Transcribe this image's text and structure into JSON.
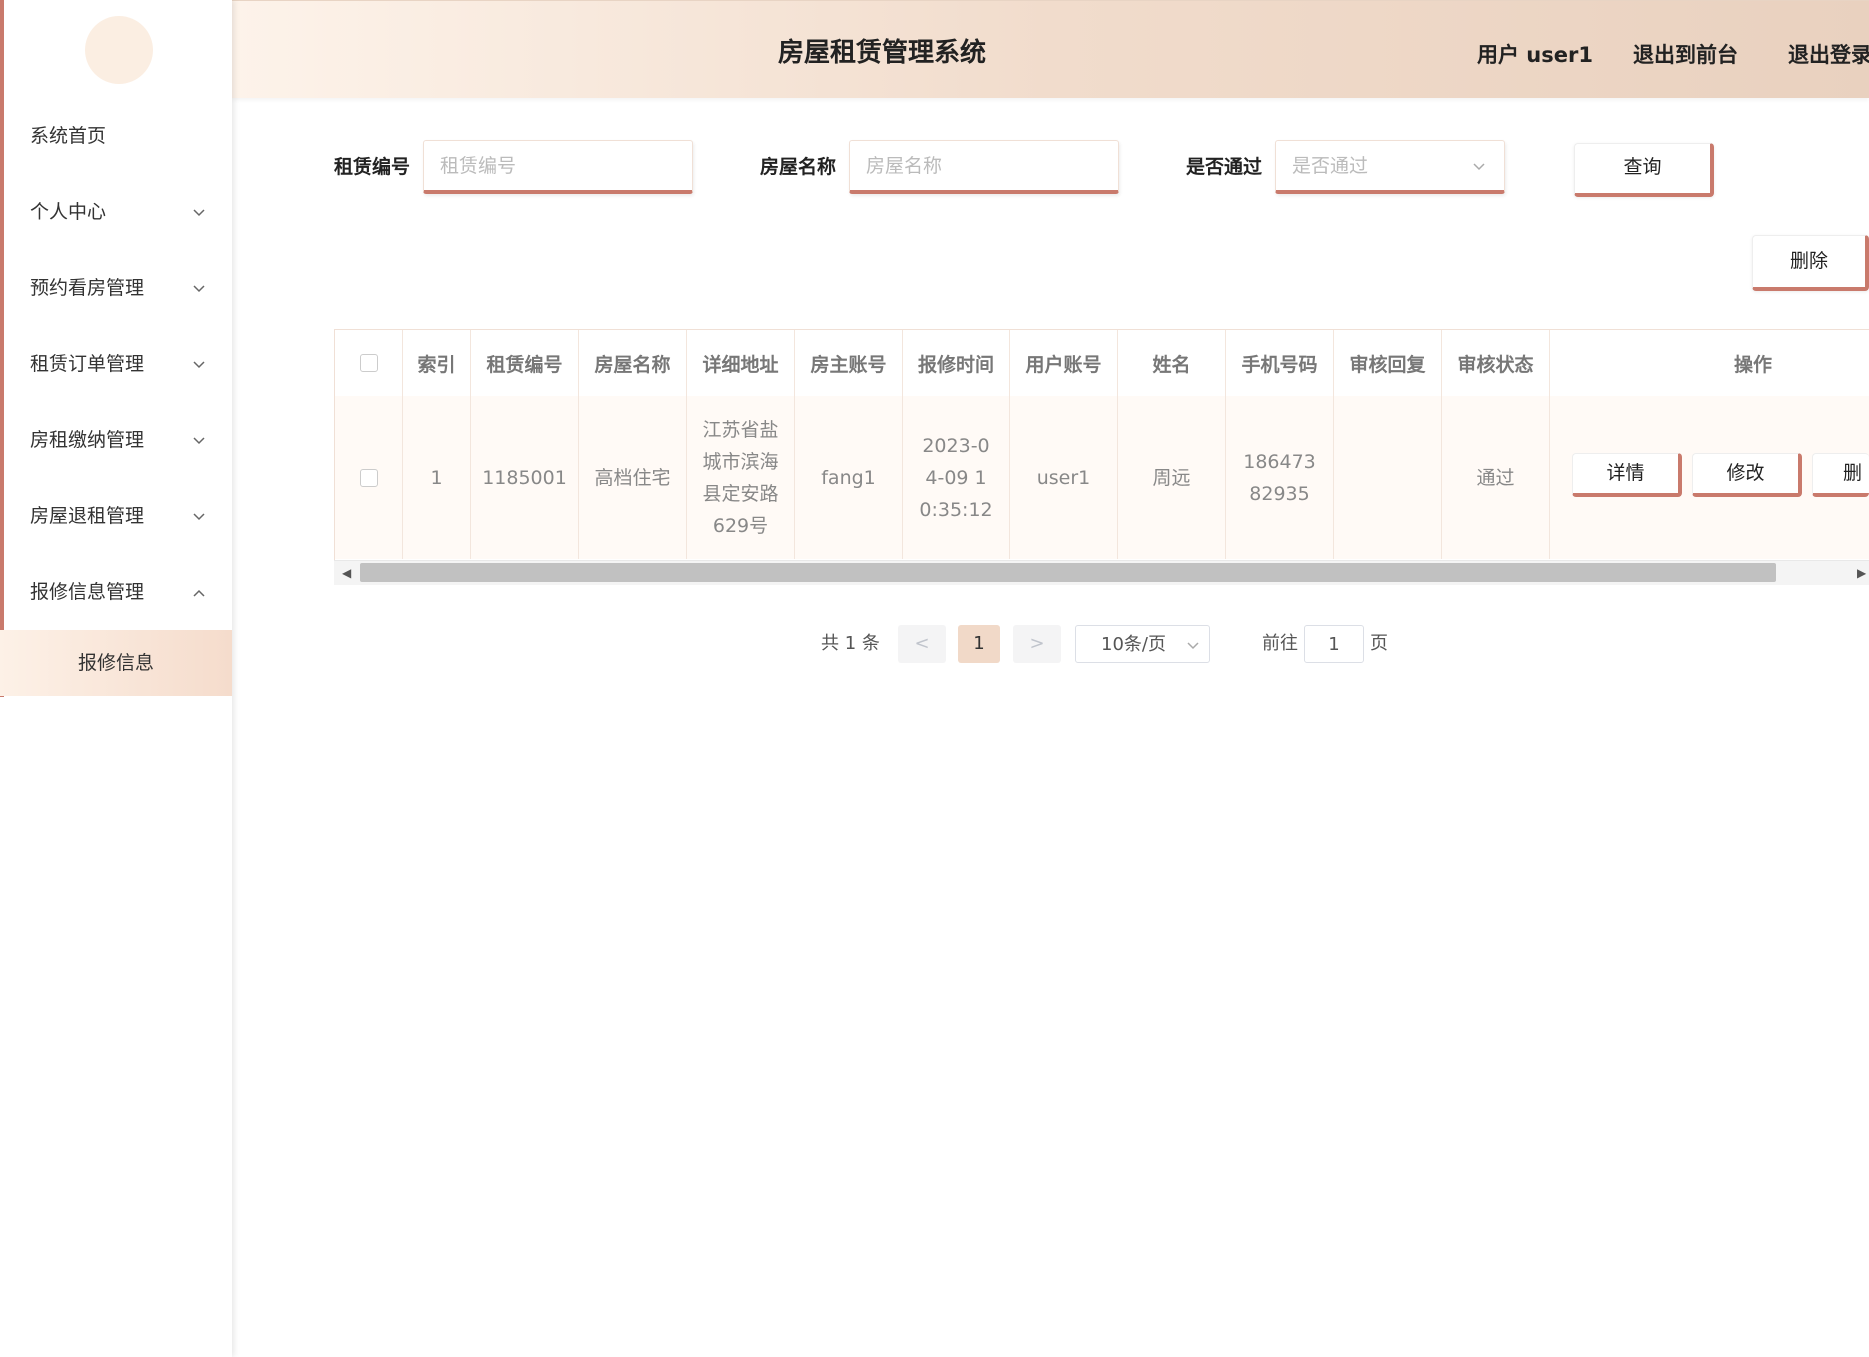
{
  "sidebar": {
    "items": [
      {
        "label": "系统首页",
        "has_chevron": false
      },
      {
        "label": "个人中心",
        "has_chevron": true
      },
      {
        "label": "预约看房管理",
        "has_chevron": true
      },
      {
        "label": "租赁订单管理",
        "has_chevron": true
      },
      {
        "label": "房租缴纳管理",
        "has_chevron": true
      },
      {
        "label": "房屋退租管理",
        "has_chevron": true
      },
      {
        "label": "报修信息管理",
        "has_chevron": true,
        "expanded": true
      }
    ],
    "submenu": {
      "label": "报修信息"
    }
  },
  "header": {
    "title": "房屋租赁管理系统",
    "user": "用户 user1",
    "front_link": "退出到前台",
    "logout": "退出登录"
  },
  "search": {
    "rental_no_label": "租赁编号",
    "rental_no_placeholder": "租赁编号",
    "house_name_label": "房屋名称",
    "house_name_placeholder": "房屋名称",
    "passed_label": "是否通过",
    "passed_placeholder": "是否通过",
    "query_button": "查询"
  },
  "toolbar": {
    "delete_button": "删除"
  },
  "table": {
    "headers": [
      "索引",
      "租赁编号",
      "房屋名称",
      "详细地址",
      "房主账号",
      "报修时间",
      "用户账号",
      "姓名",
      "手机号码",
      "审核回复",
      "审核状态",
      "操作"
    ],
    "rows": [
      {
        "index": "1",
        "rental_no": "1185001",
        "house_name": "高档住宅",
        "address": "江苏省盐城市滨海县定安路629号",
        "owner_account": "fang1",
        "repair_time": "2023-04-09 10:35:12",
        "user_account": "user1",
        "name": "周远",
        "phone": "18647382935",
        "review_reply": "",
        "review_status": "通过",
        "actions": {
          "detail": "详情",
          "edit": "修改",
          "delete": "删除"
        }
      }
    ]
  },
  "pagination": {
    "total": "共 1 条",
    "prev": "<",
    "current_page": "1",
    "next": ">",
    "page_size": "10条/页",
    "goto_label": "前往",
    "goto_value": "1",
    "page_suffix": "页"
  },
  "colors": {
    "accent": "#c97a6c",
    "header_start": "#fdf3ea",
    "header_end": "#e9d1bf"
  }
}
